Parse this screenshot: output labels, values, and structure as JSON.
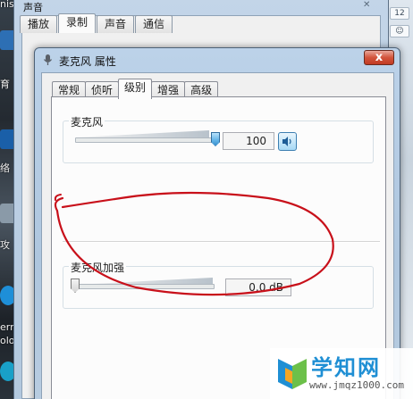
{
  "desktop": {
    "left_labels": [
      "nis",
      "育",
      "络",
      "攻",
      "ern",
      "olor"
    ],
    "right_chips": [
      "12",
      "☺"
    ]
  },
  "back_dialog": {
    "title": "声音",
    "tabs": [
      "播放",
      "录制",
      "声音",
      "通信"
    ],
    "active_tab": "录制"
  },
  "dialog": {
    "title": "麦克风 属性",
    "close_label": "x",
    "tabs": [
      "常规",
      "侦听",
      "级别",
      "增强",
      "高级"
    ],
    "active_tab": "级别",
    "microphone": {
      "label": "麦克风",
      "value": "100",
      "level_fraction": 1.0,
      "speaker_icon": "speaker-icon"
    },
    "boost": {
      "label": "麦克风加强",
      "value": "0.0 dB",
      "level_fraction": 0.0
    }
  },
  "annotation": {
    "color": "#c8101a"
  },
  "watermark": {
    "title": "学知网",
    "url": "www.jmqz1000.com"
  }
}
